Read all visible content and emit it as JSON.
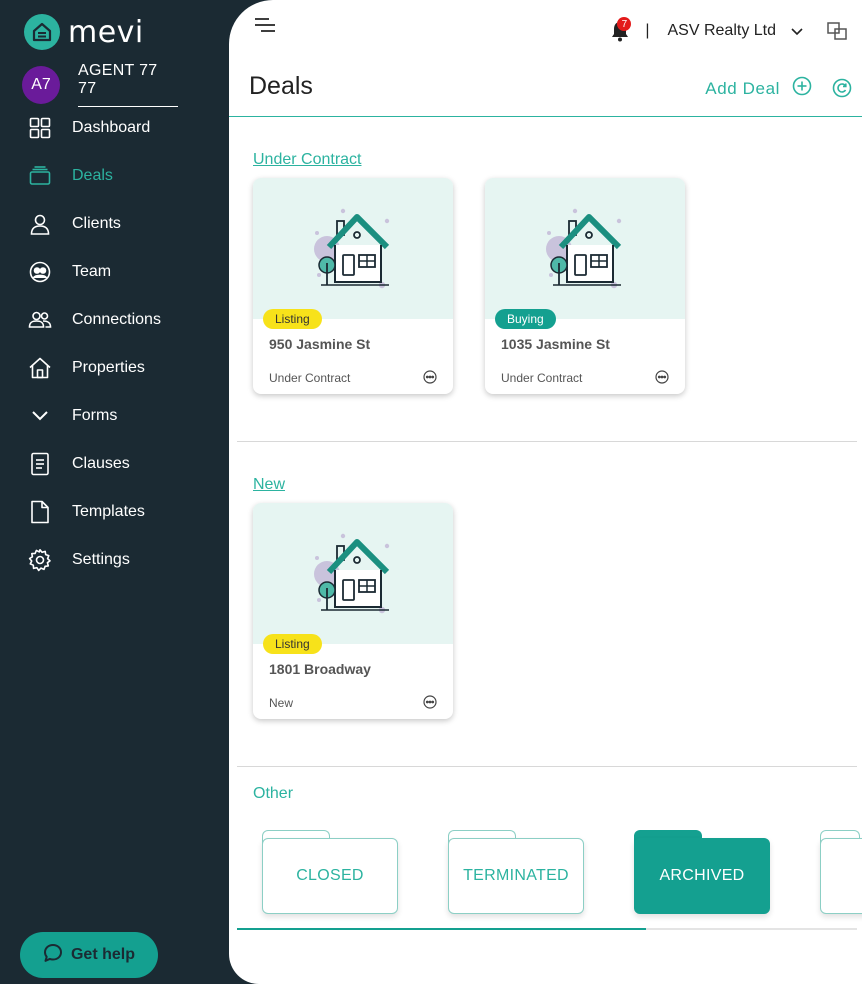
{
  "app": {
    "logo_text": "mevi"
  },
  "agent": {
    "initials": "A7",
    "name": "AGENT 77 77"
  },
  "sidebar": {
    "items": [
      {
        "label": "Dashboard",
        "icon": "dashboard-icon"
      },
      {
        "label": "Deals",
        "icon": "deals-icon",
        "active": true
      },
      {
        "label": "Clients",
        "icon": "person-icon"
      },
      {
        "label": "Team",
        "icon": "team-icon"
      },
      {
        "label": "Connections",
        "icon": "connections-icon"
      },
      {
        "label": "Properties",
        "icon": "home-icon"
      },
      {
        "label": "Forms",
        "icon": "chevron-down-icon"
      },
      {
        "label": "Clauses",
        "icon": "document-icon"
      },
      {
        "label": "Templates",
        "icon": "file-icon"
      },
      {
        "label": "Settings",
        "icon": "gear-icon"
      }
    ],
    "help_label": "Get help"
  },
  "header": {
    "notification_count": "7",
    "separator": "|",
    "org_name": "ASV Realty Ltd"
  },
  "page": {
    "title": "Deals",
    "add_deal_label": "Add Deal"
  },
  "sections": {
    "under_contract": {
      "title": "Under Contract",
      "cards": [
        {
          "tag": "Listing",
          "address": "950 Jasmine St",
          "status": "Under Contract"
        },
        {
          "tag": "Buying",
          "address": "1035 Jasmine St",
          "status": "Under Contract"
        }
      ]
    },
    "new": {
      "title": "New",
      "cards": [
        {
          "tag": "Listing",
          "address": "1801 Broadway",
          "status": "New"
        }
      ]
    },
    "other": {
      "title": "Other",
      "folders": [
        {
          "label": "CLOSED"
        },
        {
          "label": "TERMINATED"
        },
        {
          "label": "ARCHIVED",
          "active": true
        }
      ],
      "scroll_fraction": 0.66
    }
  },
  "colors": {
    "accent": "#2cb3a0",
    "accent_dark": "#14a090",
    "sidebar_bg": "#1b2a33",
    "listing_tag": "#f7e21a",
    "badge": "#e31b1b",
    "avatar": "#6a1b9a"
  }
}
